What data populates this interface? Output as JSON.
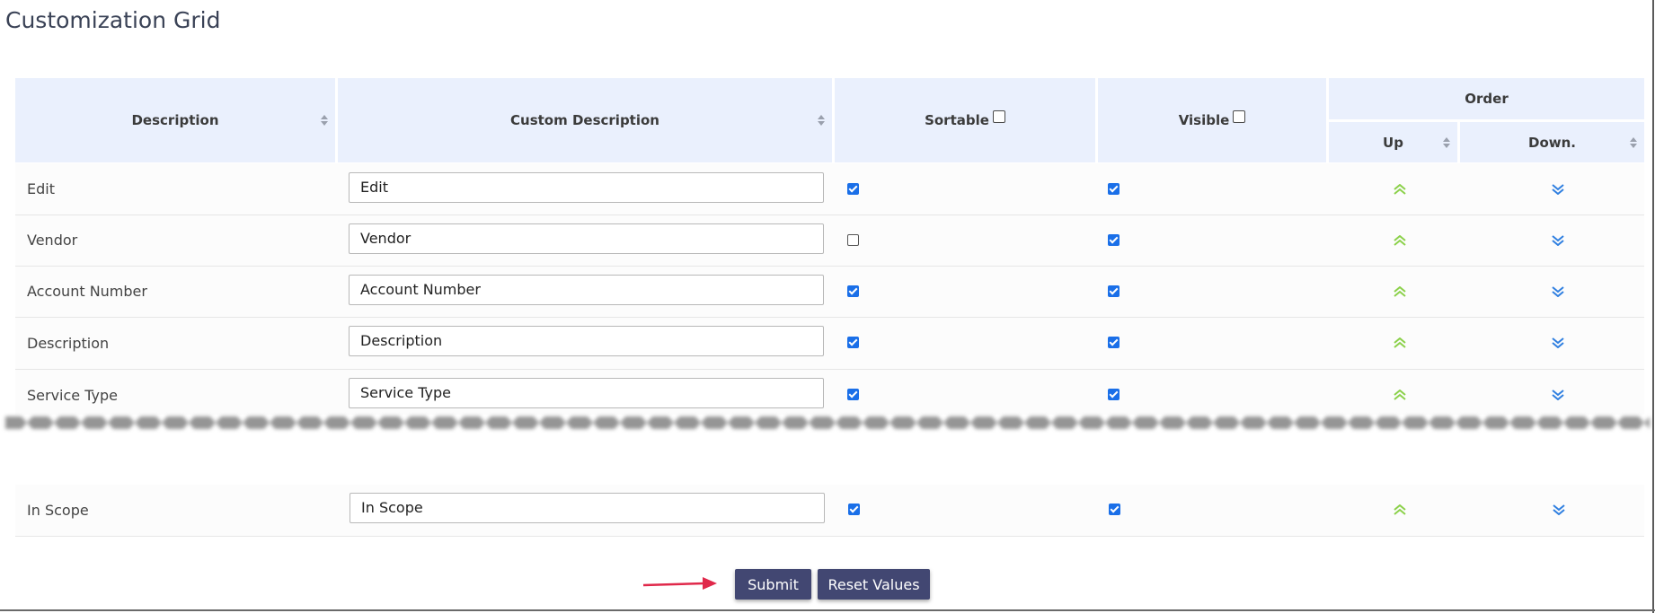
{
  "page_title": "Customization Grid",
  "columns": {
    "description": "Description",
    "custom_description": "Custom Description",
    "sortable": "Sortable",
    "visible": "Visible",
    "order": "Order",
    "up": "Up",
    "down": "Down."
  },
  "rows": [
    {
      "description": "Edit",
      "custom": "Edit",
      "sortable": true,
      "visible": true
    },
    {
      "description": "Vendor",
      "custom": "Vendor",
      "sortable": false,
      "visible": true
    },
    {
      "description": "Account Number",
      "custom": "Account Number",
      "sortable": true,
      "visible": true
    },
    {
      "description": "Description",
      "custom": "Description",
      "sortable": true,
      "visible": true
    },
    {
      "description": "Service Type",
      "custom": "Service Type",
      "sortable": true,
      "visible": true
    },
    {
      "description": "In Scope",
      "custom": "In Scope",
      "sortable": true,
      "visible": true
    }
  ],
  "buttons": {
    "submit": "Submit",
    "reset": "Reset Values"
  },
  "icons": {
    "up": "chevron-double-up-icon",
    "down": "chevron-double-down-icon",
    "sort": "sort-icon",
    "pointer_arrow": "red-arrow-icon"
  },
  "colors": {
    "header_bg": "#eaf0fd",
    "button_bg": "#424772",
    "checkbox_on": "#1a6fe8",
    "up_arrow": "#8bd14a",
    "down_arrow": "#2f7fe0",
    "pointer_arrow": "#e0284a"
  }
}
